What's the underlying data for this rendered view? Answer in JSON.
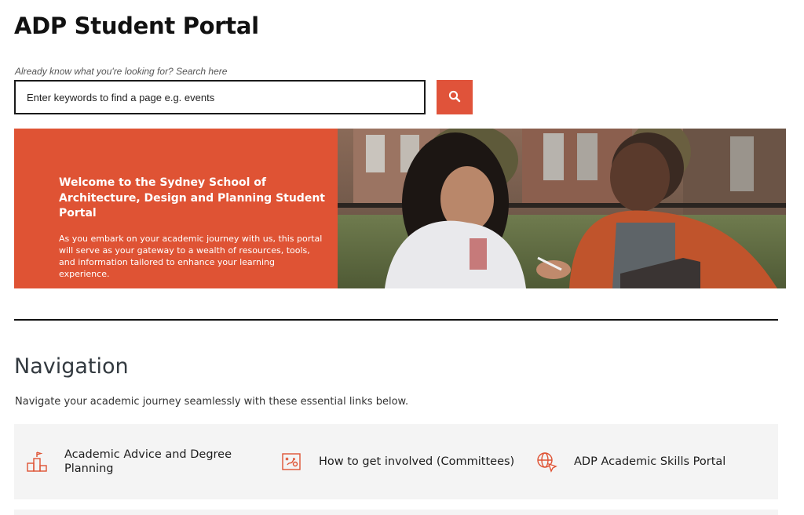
{
  "page": {
    "title": "ADP Student Portal"
  },
  "search": {
    "hint": "Already know what you're looking for? Search here",
    "placeholder": "Enter keywords to find a page e.g. events",
    "button_icon": "search-icon"
  },
  "hero": {
    "heading": "Welcome to the Sydney School of Architecture, Design and Planning Student Portal",
    "body": "As you embark on your academic journey with us, this portal will serve as your gateway to a wealth of resources, tools, and information tailored to enhance your learning experience.",
    "image": "students-studying-photo"
  },
  "navigation": {
    "heading": "Navigation",
    "description": "Navigate your academic journey seamlessly with these essential links below.",
    "items": [
      {
        "label": "Academic Advice and Degree Planning",
        "icon": "podium-icon"
      },
      {
        "label": "How to get involved (Committees)",
        "icon": "strategy-board-icon"
      },
      {
        "label": "ADP Academic Skills Portal",
        "icon": "globe-cursor-icon"
      }
    ]
  },
  "colors": {
    "accent": "#df5334",
    "panel": "#f4f4f4",
    "text": "#111111"
  }
}
